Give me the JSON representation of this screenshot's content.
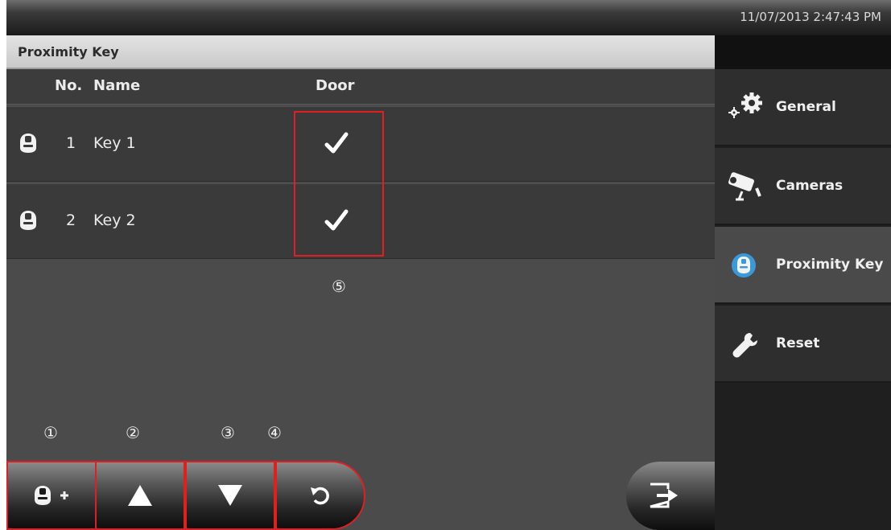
{
  "status_bar": {
    "datetime": "11/07/2013 2:47:43 PM"
  },
  "page": {
    "title": "Proximity Key"
  },
  "table": {
    "headers": {
      "no": "No.",
      "name": "Name",
      "door": "Door"
    },
    "rows": [
      {
        "no": "1",
        "name": "Key 1",
        "door_checked": true
      },
      {
        "no": "2",
        "name": "Key 2",
        "door_checked": true
      }
    ]
  },
  "markers": {
    "m1": "①",
    "m2": "②",
    "m3": "③",
    "m4": "④",
    "m5": "⑤"
  },
  "toolbar": {
    "add_icon": "key-add-icon",
    "up_icon": "arrow-up-icon",
    "down_icon": "arrow-down-icon",
    "undo_icon": "undo-icon",
    "exit_icon": "exit-icon"
  },
  "sidebar": {
    "items": [
      {
        "label": "General",
        "icon": "gear-icon"
      },
      {
        "label": "Cameras",
        "icon": "camera-icon"
      },
      {
        "label": "Proximity Key",
        "icon": "proximity-key-icon",
        "active": true
      },
      {
        "label": "Reset",
        "icon": "wrench-icon"
      }
    ]
  },
  "colors": {
    "highlight": "#e02020",
    "accent": "#3a9ad9"
  }
}
